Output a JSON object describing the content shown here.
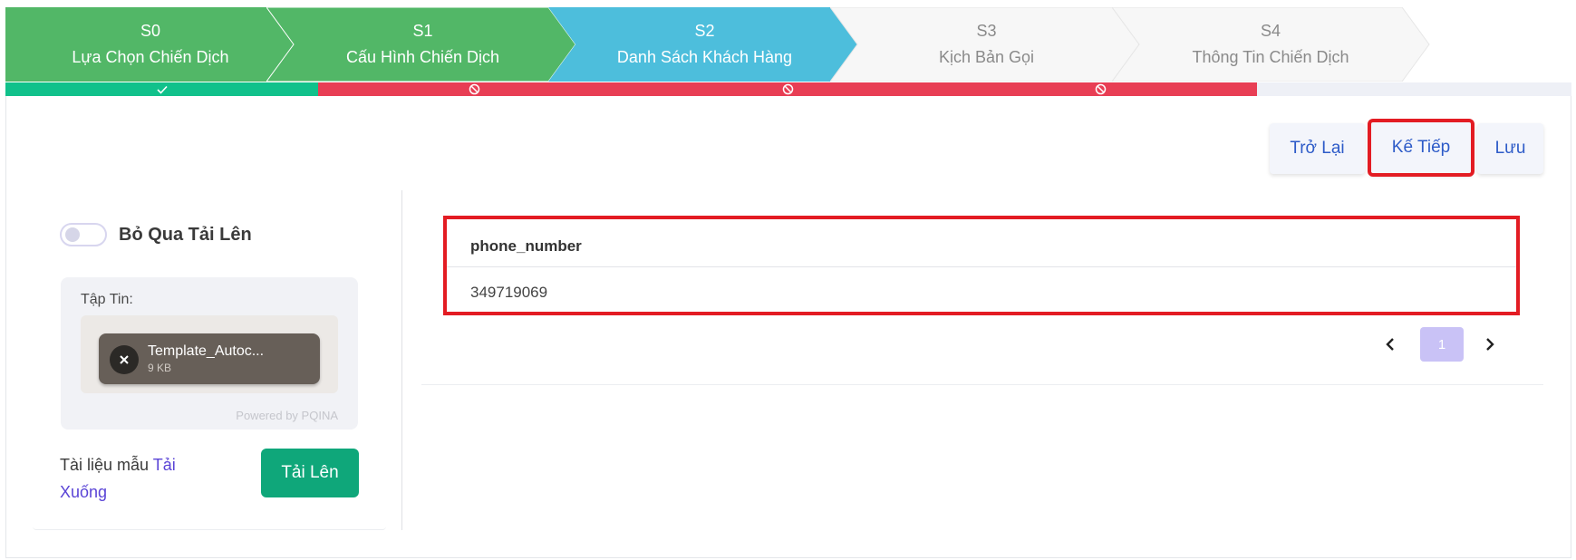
{
  "stepper": {
    "steps": [
      {
        "code": "S0",
        "title": "Lựa Chọn Chiến Dịch",
        "state": "done",
        "color": "#52b767"
      },
      {
        "code": "S1",
        "title": "Cấu Hình Chiến Dịch",
        "state": "done",
        "color": "#52b767"
      },
      {
        "code": "S2",
        "title": "Danh Sách Khách Hàng",
        "state": "active",
        "color": "#4dbedc"
      },
      {
        "code": "S3",
        "title": "Kịch Bản Gọi",
        "state": "pending",
        "color": "#f7f7f7"
      },
      {
        "code": "S4",
        "title": "Thông Tin Chiến Dịch",
        "state": "pending",
        "color": "#f7f7f7"
      }
    ],
    "progress": [
      {
        "state": "ok",
        "icon": "check-icon",
        "color": "#11c18b"
      },
      {
        "state": "blocked",
        "icon": "ban-icon",
        "color": "#e83e54"
      },
      {
        "state": "blocked",
        "icon": "ban-icon",
        "color": "#e83e54"
      },
      {
        "state": "blocked",
        "icon": "ban-icon",
        "color": "#e83e54"
      },
      {
        "state": "empty",
        "icon": "",
        "color": "#eef0f6"
      }
    ]
  },
  "actions": {
    "back_label": "Trở Lại",
    "next_label": "Kế Tiếp",
    "save_label": "Lưu"
  },
  "upload": {
    "skip_label": "Bỏ Qua Tải Lên",
    "skip_enabled": false,
    "file_label": "Tập Tin:",
    "file_name": "Template_Autoc...",
    "file_size": "9 KB",
    "powered_by": "Powered by PQINA",
    "template_text": "Tài liệu mẫu",
    "download_link": "Tải Xuống",
    "upload_button": "Tải Lên"
  },
  "table": {
    "columns": [
      "phone_number"
    ],
    "rows": [
      [
        "349719069"
      ]
    ]
  },
  "pagination": {
    "current_page": "1"
  },
  "colors": {
    "highlight": "#e31c23",
    "primary_button": "#0fa77a",
    "link": "#5a44d6"
  }
}
